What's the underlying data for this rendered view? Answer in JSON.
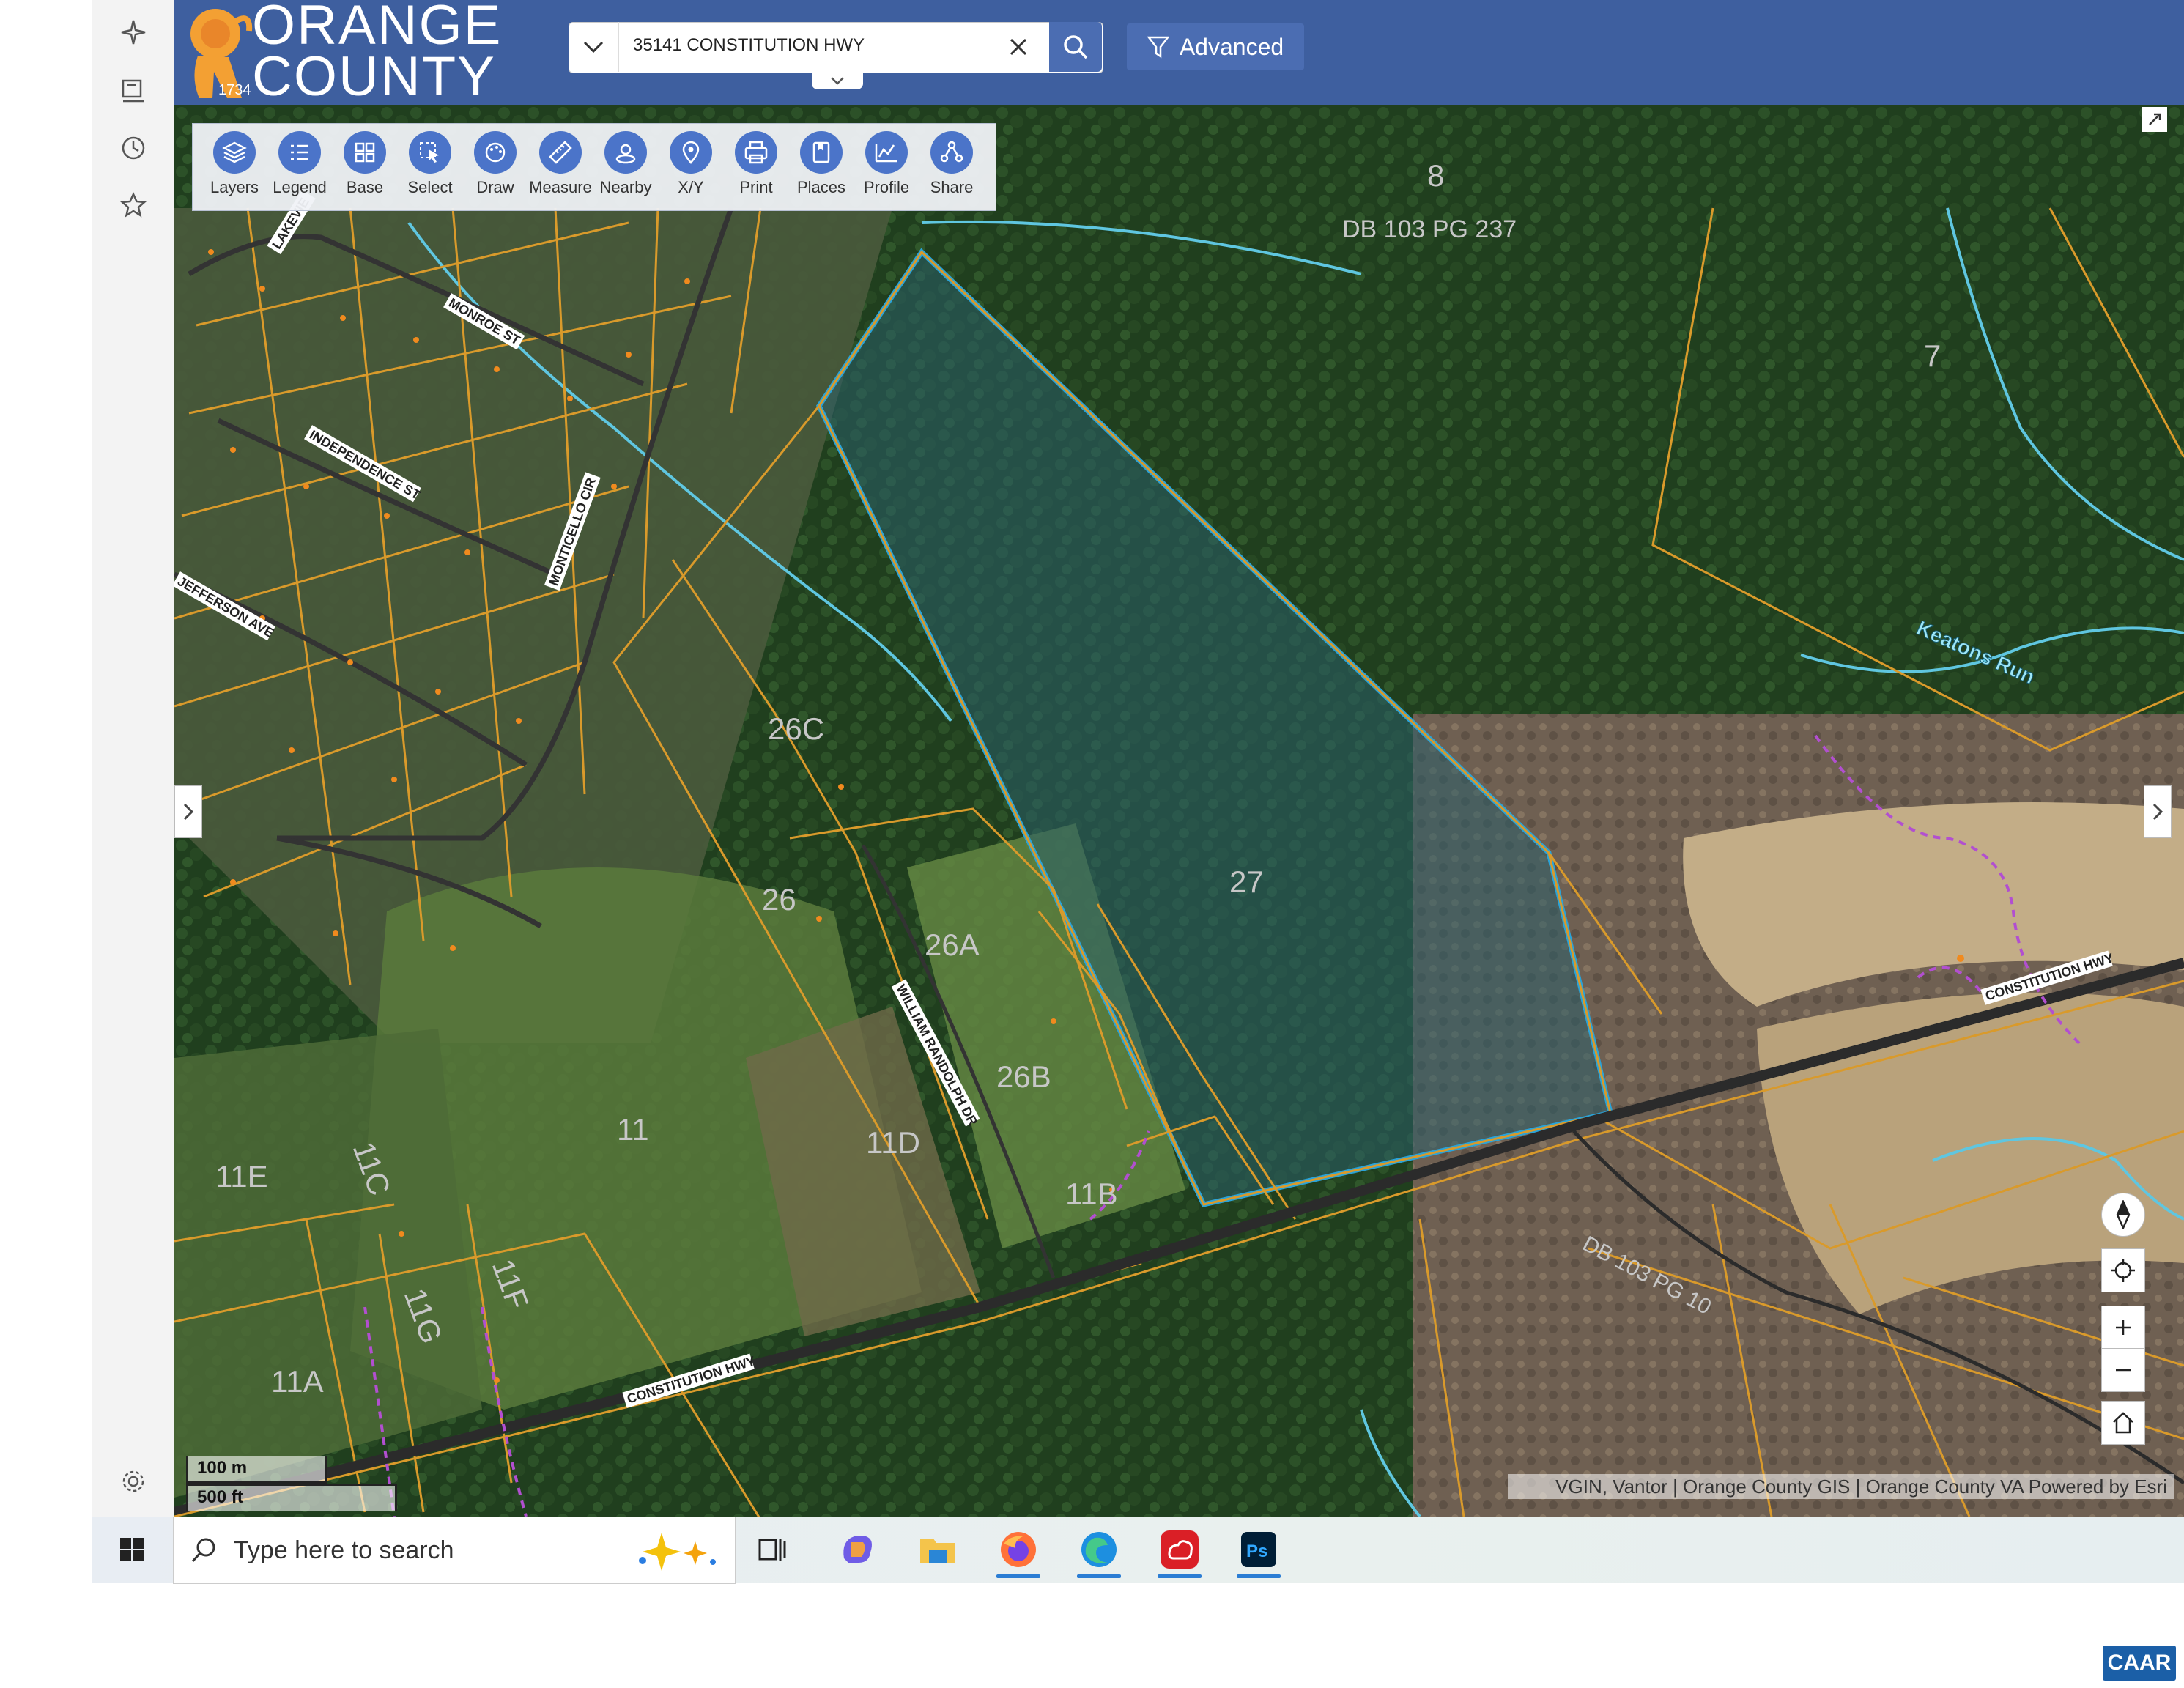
{
  "header": {
    "logo_line1": "ORANGE",
    "logo_line2": "COUNTY",
    "logo_year": "1734",
    "search_value": "35141 CONSTITUTION HWY",
    "advanced_label": "Advanced"
  },
  "toolbar": {
    "items": [
      {
        "label": "Layers",
        "icon": "layers-icon"
      },
      {
        "label": "Legend",
        "icon": "legend-icon"
      },
      {
        "label": "Base",
        "icon": "basemap-icon"
      },
      {
        "label": "Select",
        "icon": "select-icon"
      },
      {
        "label": "Draw",
        "icon": "draw-icon"
      },
      {
        "label": "Measure",
        "icon": "ruler-icon"
      },
      {
        "label": "Nearby",
        "icon": "nearby-icon"
      },
      {
        "label": "X/Y",
        "icon": "pin-icon"
      },
      {
        "label": "Print",
        "icon": "print-icon"
      },
      {
        "label": "Places",
        "icon": "bookmark-icon"
      },
      {
        "label": "Profile",
        "icon": "profile-icon"
      },
      {
        "label": "Share",
        "icon": "share-icon"
      }
    ]
  },
  "map": {
    "parcels": {
      "p8": "8",
      "p8_deed": "DB 103 PG 237",
      "p7": "7",
      "p26c": "26C",
      "p26": "26",
      "p26a": "26A",
      "p26b": "26B",
      "p27": "27",
      "p11": "11",
      "p11d": "11D",
      "p11b": "11B",
      "p11e": "11E",
      "p11c": "11C",
      "p11g": "11G",
      "p11f": "11F",
      "p11a": "11A",
      "deed_se": "DB 103 PG 10"
    },
    "roads": {
      "lakeview": "LAKEVIE",
      "monroe": "MONROE ST",
      "independence": "INDEPENDENCE ST",
      "monticello": "MONTICELLO CIR",
      "jefferson": "JEFFERSON AVE",
      "william": "WILLIAM RANDOLPH DR",
      "constitution_w": "CONSTITUTION HWY",
      "constitution_e": "CONSTITUTION HWY"
    },
    "stream_label": "Keatons Run",
    "scale_metric": "100 m",
    "scale_imperial": "500 ft",
    "attribution": "VGIN, Vantor | Orange County GIS | Orange County VA    Powered by Esri",
    "colors": {
      "parcel_line": "#d99a2b",
      "selected_outline": "#2aa3d8",
      "stream": "#5fc6e0",
      "accent": "#3e5f9f"
    }
  },
  "taskbar": {
    "search_placeholder": "Type here to search",
    "apps": [
      "task-view-icon",
      "copilot-icon",
      "file-explorer-icon",
      "firefox-icon",
      "edge-icon",
      "creative-cloud-icon",
      "photoshop-icon"
    ]
  },
  "watermark": "CAAR"
}
